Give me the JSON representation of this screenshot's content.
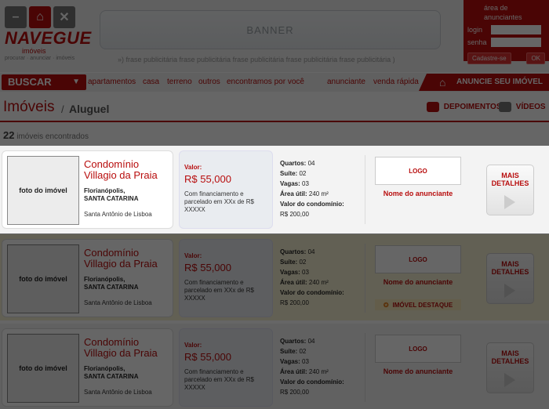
{
  "header": {
    "logo_word": "NAVEGUE",
    "logo_sub": "imóveis",
    "logo_tagline": "procurar · anunciar · imóveis",
    "banner": "BANNER",
    "phrase": "»)  frase publicitária frase publicitária frase publicitária frase publicitária frase publicitária )",
    "login": {
      "title": "área de anunciantes",
      "login_label": "login",
      "senha_label": "senha",
      "cadastre_label": "Cadastre-se",
      "ok_label": "OK"
    }
  },
  "nav": {
    "buscar": "BUSCAR",
    "items": [
      "apartamentos",
      "casa",
      "terreno",
      "outros",
      "encontramos por você",
      "anunciante",
      "venda rápida"
    ],
    "anuncie": "ANUNCIE SEU IMÓVEL"
  },
  "title": {
    "main": "Imóveis",
    "sep": "/",
    "sub": "Aluguel",
    "depoimentos": "DEPOIMENTOS",
    "videos": "VÍDEOS"
  },
  "results": {
    "count": "22",
    "label": "imóveis encontrados"
  },
  "listings": [
    {
      "photo": "foto do imóvel",
      "name": "Condomínio Villagio da Praia",
      "city": "Florianópolis,",
      "state": "SANTA CATARINA",
      "bairro": "Santa Antônio de Lisboa",
      "valor_label": "Valor:",
      "valor": "R$ 55,000",
      "financiamento": "Com financiamento e parcelado em XXx de R$ XXXXX",
      "quartos_label": "Quartos:",
      "quartos": "04",
      "suite_label": "Suíte:",
      "suite": "02",
      "vagas_label": "Vagas:",
      "vagas": "03",
      "area_label": "Área útil:",
      "area": "240 m²",
      "condominio_label": "Valor do condomínio:",
      "condominio": "R$ 200,00",
      "logo": "LOGO",
      "anunciante": "Nome do anunciante",
      "mais": "MAIS DETALHES"
    },
    {
      "photo": "foto do imóvel",
      "name": "Condomínio Villagio da Praia",
      "city": "Florianópolis,",
      "state": "SANTA CATARINA",
      "bairro": "Santa Antônio de Lisboa",
      "valor_label": "Valor:",
      "valor": "R$ 55,000",
      "financiamento": "Com financiamento e parcelado em XXx de R$ XXXXX",
      "quartos_label": "Quartos:",
      "quartos": "04",
      "suite_label": "Suíte:",
      "suite": "02",
      "vagas_label": "Vagas:",
      "vagas": "03",
      "area_label": "Área útil:",
      "area": "240 m²",
      "condominio_label": "Valor do condomínio:",
      "condominio": "R$ 200,00",
      "logo": "LOGO",
      "anunciante": "Nome do anunciante",
      "destaque": "IMÓVEL DESTAQUE",
      "mais": "MAIS DETALHES"
    },
    {
      "photo": "foto do imóvel",
      "name": "Condomínio Villagio da Praia",
      "city": "Florianópolis,",
      "state": "SANTA CATARINA",
      "bairro": "Santa Antônio de Lisboa",
      "valor_label": "Valor:",
      "valor": "R$ 55,000",
      "financiamento": "Com financiamento e parcelado em XXx de R$ XXXXX",
      "quartos_label": "Quartos:",
      "quartos": "04",
      "suite_label": "Suíte:",
      "suite": "02",
      "vagas_label": "Vagas:",
      "vagas": "03",
      "area_label": "Área útil:",
      "area": "240 m²",
      "condominio_label": "Valor do condomínio:",
      "condominio": "R$ 200,00",
      "logo": "LOGO",
      "anunciante": "Nome do anunciante",
      "mais": "MAIS DETALHES"
    }
  ],
  "colors": {
    "brand": "#b80d0d",
    "highlight_row": "#f6f1d2",
    "overlay": "rgba(0,0,0,0.6)"
  }
}
